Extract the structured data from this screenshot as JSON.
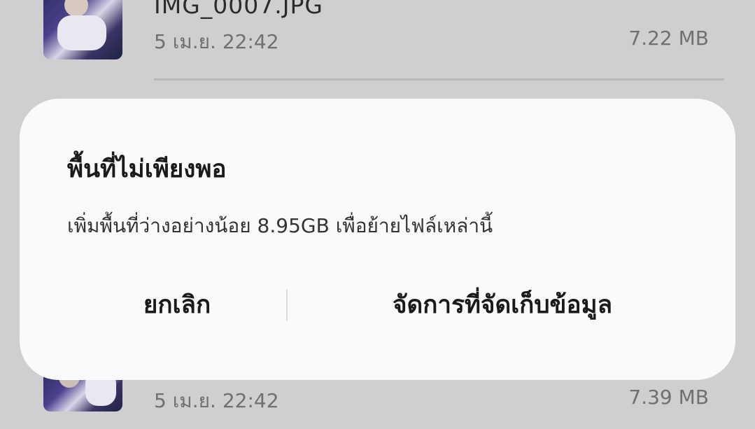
{
  "file_list": {
    "items": [
      {
        "name": "IMG_0007.JPG",
        "date": "5 เม.ย. 22:42",
        "size": "7.22 MB"
      },
      {
        "name": "",
        "date": "5 เม.ย. 22:42",
        "size": "7.39 MB"
      }
    ]
  },
  "dialog": {
    "title": "พื้นที่ไม่เพียงพอ",
    "message": "เพิ่มพื้นที่ว่างอย่างน้อย 8.95GB เพื่อย้ายไฟล์เหล่านี้",
    "cancel_label": "ยกเลิก",
    "manage_storage_label": "จัดการที่จัดเก็บข้อมูล"
  }
}
